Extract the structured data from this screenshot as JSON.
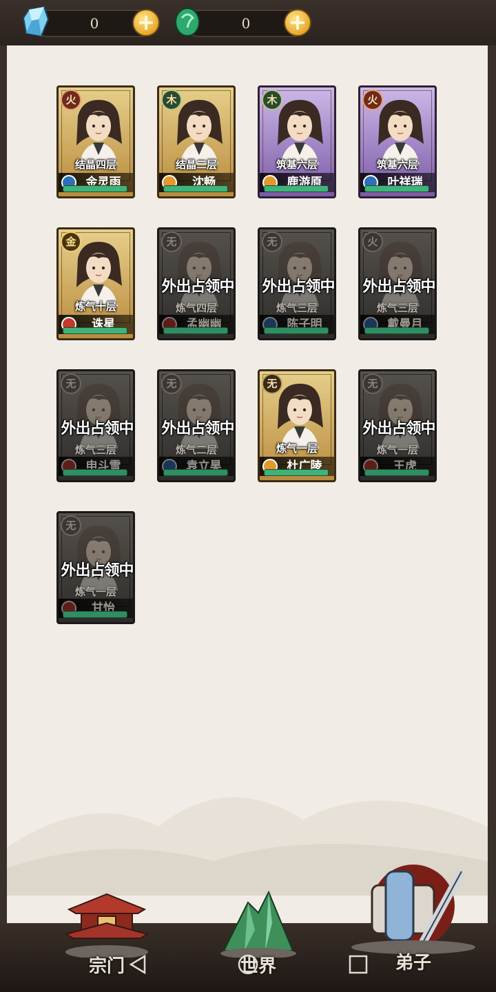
{
  "currency": {
    "spirit_stones": "0",
    "jade": "0"
  },
  "status_overlay": "外出占领中",
  "disciples": [
    {
      "element": "火",
      "element_type": "fire",
      "level": "结晶四层",
      "name": "金灵雨",
      "sect": "blue",
      "state": "gold",
      "away": false
    },
    {
      "element": "木",
      "element_type": "wood",
      "level": "结晶二层",
      "name": "沈畅",
      "sect": "orange",
      "state": "gold",
      "away": false
    },
    {
      "element": "木",
      "element_type": "wood",
      "level": "筑基六层",
      "name": "鹿游原",
      "sect": "orange",
      "state": "purple",
      "away": false
    },
    {
      "element": "火",
      "element_type": "fire",
      "level": "筑基六层",
      "name": "叶祥瑞",
      "sect": "blue",
      "state": "purple",
      "away": false
    },
    {
      "element": "金",
      "element_type": "metal",
      "level": "炼气十层",
      "name": "诛星",
      "sect": "red",
      "state": "gold",
      "away": false
    },
    {
      "element": "无",
      "element_type": "none",
      "level": "炼气四层",
      "name": "孟幽幽",
      "sect": "red",
      "state": "grey",
      "away": true
    },
    {
      "element": "无",
      "element_type": "none",
      "level": "炼气三层",
      "name": "陈子明",
      "sect": "blue",
      "state": "grey",
      "away": true
    },
    {
      "element": "火",
      "element_type": "none",
      "level": "炼气三层",
      "name": "戴曼月",
      "sect": "blue",
      "state": "grey",
      "away": true
    },
    {
      "element": "无",
      "element_type": "none",
      "level": "炼气三层",
      "name": "申斗雪",
      "sect": "red",
      "state": "grey",
      "away": true
    },
    {
      "element": "无",
      "element_type": "none",
      "level": "炼气二层",
      "name": "袁立昊",
      "sect": "blue",
      "state": "grey",
      "away": true
    },
    {
      "element": "无",
      "element_type": "none",
      "level": "炼气一层",
      "name": "杜广陵",
      "sect": "orange",
      "state": "gold",
      "away": false
    },
    {
      "element": "无",
      "element_type": "none",
      "level": "炼气一层",
      "name": "王虎",
      "sect": "red",
      "state": "grey",
      "away": true
    },
    {
      "element": "无",
      "element_type": "none",
      "level": "炼气一层",
      "name": "甘怡",
      "sect": "red",
      "state": "grey",
      "away": true
    }
  ],
  "nav": {
    "sect": "宗门",
    "world": "世界",
    "disciples": "弟子"
  },
  "colors": {
    "paper": "#f1ede6",
    "frame": "#3a302a",
    "progress": "#3fb37a"
  }
}
